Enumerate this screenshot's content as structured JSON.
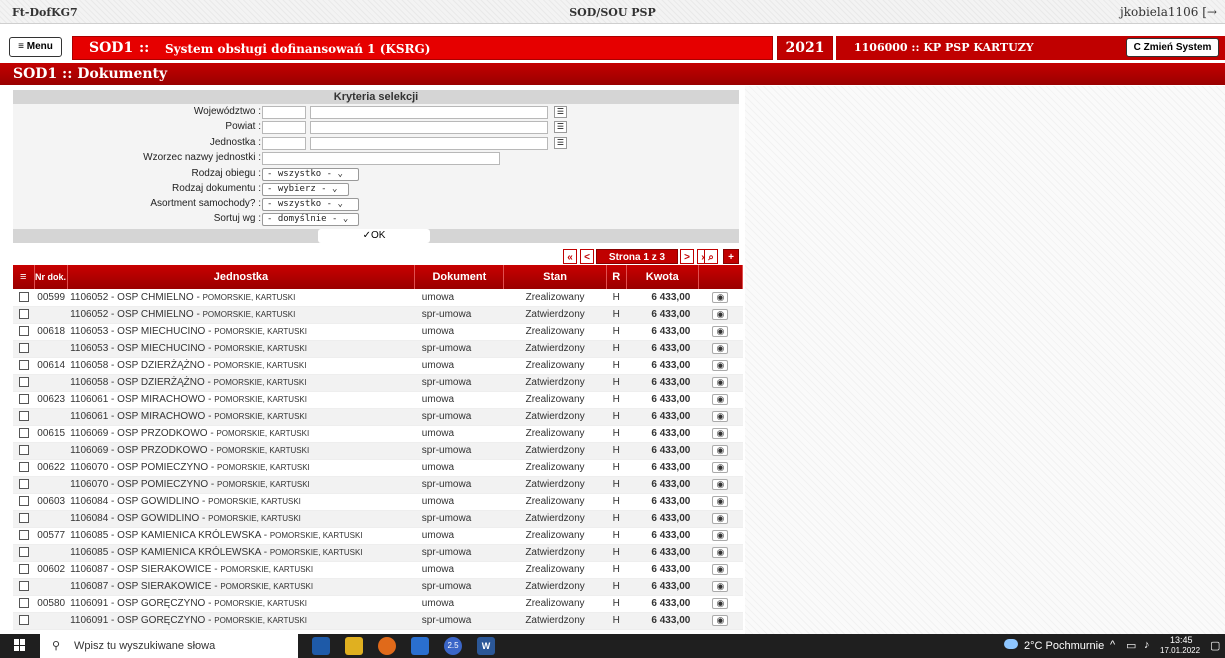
{
  "topbar": {
    "left": "Ft-DofKG7",
    "center": "SOD/SOU PSP",
    "user": "jkobiela1106",
    "logout_glyph": "[→"
  },
  "header": {
    "menu_label": "≡ Menu",
    "system_code": "SOD1",
    "system_sep": "::",
    "system_name": "System obsługi dofinansowań 1 (KSRG)",
    "year": "2021",
    "unit": "1106000 :: KP PSP KARTUZY",
    "change_label": "C Zmień System"
  },
  "page_title": "SOD1 :: Dokumenty",
  "criteria": {
    "title": "Kryteria selekcji",
    "labels": {
      "wojewodztwo": "Województwo :",
      "powiat": "Powiat :",
      "jednostka": "Jednostka :",
      "wzorzec": "Wzorzec nazwy jednostki :",
      "rodzaj_obiegu": "Rodzaj obiegu :",
      "rodzaj_dokumentu": "Rodzaj dokumentu :",
      "asortment": "Asortment samochody? :",
      "sortuj": "Sortuj wg :"
    },
    "selects": {
      "rodzaj_obiegu": "- wszystko -",
      "rodzaj_dokumentu": "- wybierz -",
      "asortment": "- wszystko -",
      "sortuj": "- domyślnie -"
    },
    "ok_label": "✓OK"
  },
  "pager": {
    "first": "«",
    "prev": "<",
    "label": "Strona 1 z 3",
    "next": ">",
    "last": "»",
    "search": "🔍",
    "add": "+"
  },
  "table": {
    "headers": {
      "menu": "≡",
      "nr": "Nr dok.",
      "jednostka": "Jednostka",
      "dokument": "Dokument",
      "stan": "Stan",
      "r": "R",
      "kwota": "Kwota"
    },
    "rows": [
      {
        "nr": "00599",
        "jed": "1106052 - OSP CHMIELNO - ",
        "loc": "POMORSKIE, KARTUSKI",
        "dok": "umowa",
        "stan": "Zrealizowany",
        "r": "H",
        "kwota": "6 433,00"
      },
      {
        "nr": "",
        "jed": "1106052 - OSP CHMIELNO - ",
        "loc": "POMORSKIE, KARTUSKI",
        "dok": "spr-umowa",
        "stan": "Zatwierdzony",
        "r": "H",
        "kwota": "6 433,00"
      },
      {
        "nr": "00618",
        "jed": "1106053 - OSP MIECHUCINO - ",
        "loc": "POMORSKIE, KARTUSKI",
        "dok": "umowa",
        "stan": "Zrealizowany",
        "r": "H",
        "kwota": "6 433,00"
      },
      {
        "nr": "",
        "jed": "1106053 - OSP MIECHUCINO - ",
        "loc": "POMORSKIE, KARTUSKI",
        "dok": "spr-umowa",
        "stan": "Zatwierdzony",
        "r": "H",
        "kwota": "6 433,00"
      },
      {
        "nr": "00614",
        "jed": "1106058 - OSP DZIERŻĄŻNO - ",
        "loc": "POMORSKIE, KARTUSKI",
        "dok": "umowa",
        "stan": "Zrealizowany",
        "r": "H",
        "kwota": "6 433,00"
      },
      {
        "nr": "",
        "jed": "1106058 - OSP DZIERŻĄŻNO - ",
        "loc": "POMORSKIE, KARTUSKI",
        "dok": "spr-umowa",
        "stan": "Zatwierdzony",
        "r": "H",
        "kwota": "6 433,00"
      },
      {
        "nr": "00623",
        "jed": "1106061 - OSP MIRACHOWO - ",
        "loc": "POMORSKIE, KARTUSKI",
        "dok": "umowa",
        "stan": "Zrealizowany",
        "r": "H",
        "kwota": "6 433,00"
      },
      {
        "nr": "",
        "jed": "1106061 - OSP MIRACHOWO - ",
        "loc": "POMORSKIE, KARTUSKI",
        "dok": "spr-umowa",
        "stan": "Zatwierdzony",
        "r": "H",
        "kwota": "6 433,00"
      },
      {
        "nr": "00615",
        "jed": "1106069 - OSP PRZODKOWO - ",
        "loc": "POMORSKIE, KARTUSKI",
        "dok": "umowa",
        "stan": "Zrealizowany",
        "r": "H",
        "kwota": "6 433,00"
      },
      {
        "nr": "",
        "jed": "1106069 - OSP PRZODKOWO - ",
        "loc": "POMORSKIE, KARTUSKI",
        "dok": "spr-umowa",
        "stan": "Zatwierdzony",
        "r": "H",
        "kwota": "6 433,00"
      },
      {
        "nr": "00622",
        "jed": "1106070 - OSP POMIECZYNO - ",
        "loc": "POMORSKIE, KARTUSKI",
        "dok": "umowa",
        "stan": "Zrealizowany",
        "r": "H",
        "kwota": "6 433,00"
      },
      {
        "nr": "",
        "jed": "1106070 - OSP POMIECZYNO - ",
        "loc": "POMORSKIE, KARTUSKI",
        "dok": "spr-umowa",
        "stan": "Zatwierdzony",
        "r": "H",
        "kwota": "6 433,00"
      },
      {
        "nr": "00603",
        "jed": "1106084 - OSP GOWIDLINO - ",
        "loc": "POMORSKIE, KARTUSKI",
        "dok": "umowa",
        "stan": "Zrealizowany",
        "r": "H",
        "kwota": "6 433,00"
      },
      {
        "nr": "",
        "jed": "1106084 - OSP GOWIDLINO - ",
        "loc": "POMORSKIE, KARTUSKI",
        "dok": "spr-umowa",
        "stan": "Zatwierdzony",
        "r": "H",
        "kwota": "6 433,00"
      },
      {
        "nr": "00577",
        "jed": "1106085 - OSP KAMIENICA KRÓLEWSKA - ",
        "loc": "POMORSKIE, KARTUSKI",
        "dok": "umowa",
        "stan": "Zrealizowany",
        "r": "H",
        "kwota": "6 433,00"
      },
      {
        "nr": "",
        "jed": "1106085 - OSP KAMIENICA KRÓLEWSKA - ",
        "loc": "POMORSKIE, KARTUSKI",
        "dok": "spr-umowa",
        "stan": "Zatwierdzony",
        "r": "H",
        "kwota": "6 433,00"
      },
      {
        "nr": "00602",
        "jed": "1106087 - OSP SIERAKOWICE - ",
        "loc": "POMORSKIE, KARTUSKI",
        "dok": "umowa",
        "stan": "Zrealizowany",
        "r": "H",
        "kwota": "6 433,00"
      },
      {
        "nr": "",
        "jed": "1106087 - OSP SIERAKOWICE - ",
        "loc": "POMORSKIE, KARTUSKI",
        "dok": "spr-umowa",
        "stan": "Zatwierdzony",
        "r": "H",
        "kwota": "6 433,00"
      },
      {
        "nr": "00580",
        "jed": "1106091 - OSP GORĘCZYNO - ",
        "loc": "POMORSKIE, KARTUSKI",
        "dok": "umowa",
        "stan": "Zrealizowany",
        "r": "H",
        "kwota": "6 433,00"
      },
      {
        "nr": "",
        "jed": "1106091 - OSP GORĘCZYNO - ",
        "loc": "POMORSKIE, KARTUSKI",
        "dok": "spr-umowa",
        "stan": "Zatwierdzony",
        "r": "H",
        "kwota": "6 433,00"
      }
    ]
  },
  "taskbar": {
    "search_placeholder": "Wpisz tu wyszukiwane słowa",
    "weather": "2°C Pochmurnie",
    "time": "13:45",
    "date": "17.01.2022",
    "badge": "2.5"
  },
  "colors": {
    "accent": "#c00000",
    "bright_red": "#e60000",
    "taskbar": "#1f1f1f"
  }
}
